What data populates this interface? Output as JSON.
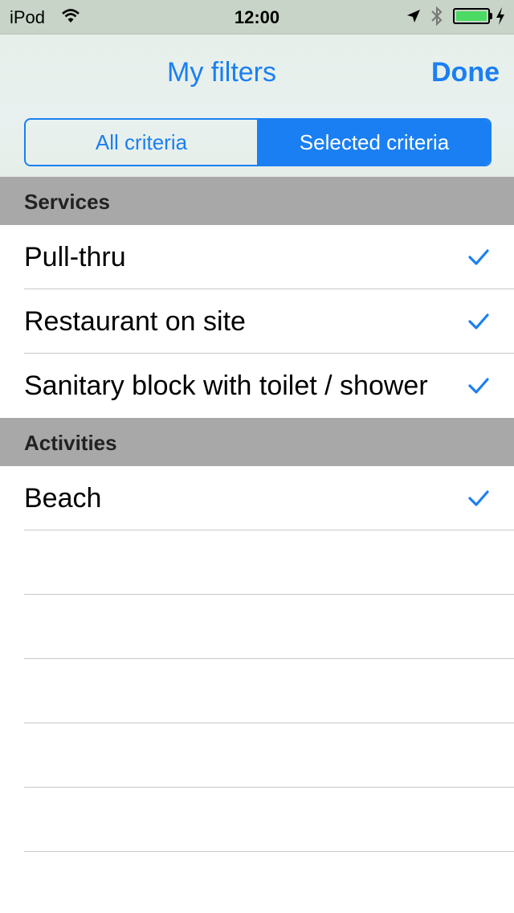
{
  "status_bar": {
    "carrier": "iPod",
    "time": "12:00",
    "icons": [
      "wifi-icon",
      "location-arrow-icon",
      "bluetooth-icon",
      "battery-icon",
      "charging-bolt-icon"
    ],
    "battery_color": "#4cd964"
  },
  "nav": {
    "title": "My filters",
    "done_label": "Done",
    "accent_color": "#1a7ff2"
  },
  "segmented": {
    "options": [
      "All criteria",
      "Selected criteria"
    ],
    "selected": "Selected criteria"
  },
  "sections": [
    {
      "title": "Services",
      "items": [
        {
          "label": "Pull-thru",
          "checked": true
        },
        {
          "label": "Restaurant on site",
          "checked": true
        },
        {
          "label": "Sanitary block with toilet / shower",
          "checked": true
        }
      ]
    },
    {
      "title": "Activities",
      "items": [
        {
          "label": "Beach",
          "checked": true
        }
      ]
    }
  ]
}
